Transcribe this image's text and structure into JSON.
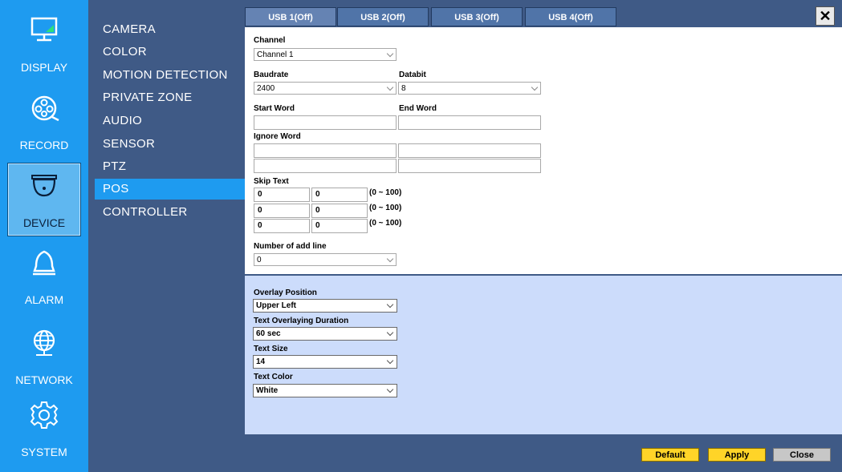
{
  "sidebar": {
    "items": [
      {
        "label": "DISPLAY",
        "icon": "monitor-icon"
      },
      {
        "label": "RECORD",
        "icon": "film-reel-icon"
      },
      {
        "label": "DEVICE",
        "icon": "dome-camera-icon"
      },
      {
        "label": "ALARM",
        "icon": "bell-icon"
      },
      {
        "label": "NETWORK",
        "icon": "globe-icon"
      },
      {
        "label": "SYSTEM",
        "icon": "gear-icon"
      }
    ],
    "active": "DEVICE"
  },
  "menu": {
    "items": [
      "CAMERA",
      "COLOR",
      "MOTION DETECTION",
      "PRIVATE ZONE",
      "AUDIO",
      "SENSOR",
      "PTZ",
      "POS",
      "CONTROLLER"
    ],
    "selected": "POS"
  },
  "tabs": [
    "USB 1(Off)",
    "USB 2(Off)",
    "USB 3(Off)",
    "USB 4(Off)"
  ],
  "close_label": "✕",
  "form": {
    "channel_label": "Channel",
    "channel_value": "Channel 1",
    "baudrate_label": "Baudrate",
    "baudrate_value": "2400",
    "databit_label": "Databit",
    "databit_value": "8",
    "start_word_label": "Start Word",
    "end_word_label": "End Word",
    "start_word_value": "",
    "end_word_value": "",
    "ignore_word_label": "Ignore Word",
    "ignore_words": [
      "",
      "",
      "",
      ""
    ],
    "skip_text_label": "Skip Text",
    "skip_rows": [
      {
        "a": "0",
        "b": "0",
        "range": "(0 ~ 100)"
      },
      {
        "a": "0",
        "b": "0",
        "range": "(0 ~ 100)"
      },
      {
        "a": "0",
        "b": "0",
        "range": "(0 ~ 100)"
      }
    ],
    "add_line_label": "Number of add line",
    "add_line_value": "0"
  },
  "overlay": {
    "position_label": "Overlay Position",
    "position_value": "Upper Left",
    "duration_label": "Text Overlaying Duration",
    "duration_value": "60 sec",
    "size_label": "Text Size",
    "size_value": "14",
    "color_label": "Text Color",
    "color_value": "White"
  },
  "footer": {
    "default_label": "Default",
    "apply_label": "Apply",
    "close_label": "Close"
  },
  "colors": {
    "sidebar": "#1e9bf0",
    "background": "#3f5a86",
    "selected_menu": "#1e9bf0",
    "overlay_panel": "#ccdcfb",
    "button_yellow": "#ffd428"
  }
}
